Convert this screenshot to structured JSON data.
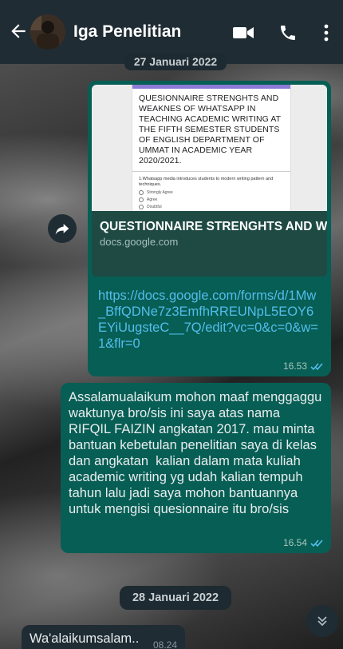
{
  "header": {
    "contact_name": "Iga Penelitian",
    "icons": [
      "back-arrow-icon",
      "avatar",
      "video-call-icon",
      "voice-call-icon",
      "more-options-icon"
    ]
  },
  "chat": {
    "date_top": "27 Januari 2022",
    "link_message": {
      "preview_form_title": "QUESIONNAIRE STRENGHTS AND WEAKNES OF WHATSAPP IN TEACHING ACADEMIC WRITING AT THE FIFTH SEMESTER STUDENTS OF ENGLISH DEPARTMENT OF UMMAT IN ACADEMIC YEAR 2020/2021.",
      "preview_question": "1.Whatsapp media introduces students to modern writing pattern and techniques.",
      "preview_options": [
        "Strongly Agree",
        "Agree",
        "Doubtful"
      ],
      "preview_title": "QUESTIONNAIRE STRENGHTS AND WEAKNESS OF WHATSAPP IN...",
      "preview_domain": "docs.google.com",
      "link": "https://docs.google.com/forms/d/1Mw_BffQDNe7z3EmfhRREUNpL5EOY6EYiUugsteC__7Q/edit?vc=0&c=0&w=1&flr=0",
      "time": "16.53"
    },
    "text_message": {
      "text": "Assalamualaikum mohon maaf menggaggu waktunya bro/sis ini saya atas nama RIFQIL FAIZIN angkatan 2017. mau minta bantuan kebetulan penelitian saya di kelas dan angkatan  kalian dalam mata kuliah academic writing yg udah kalian tempuh tahun lalu jadi saya mohon bantuannya untuk mengisi quesionnaire itu bro/sis",
      "time": "16.54"
    },
    "date_chip": "28 Januari 2022",
    "incoming_message": {
      "text": "Wa'alaikumsalam..",
      "time": "08.24"
    }
  },
  "colors": {
    "header_bg": "#1f2c34",
    "outgoing_bubble": "#075e54",
    "link_color": "#53bdeb",
    "read_ticks": "#53bdeb"
  }
}
